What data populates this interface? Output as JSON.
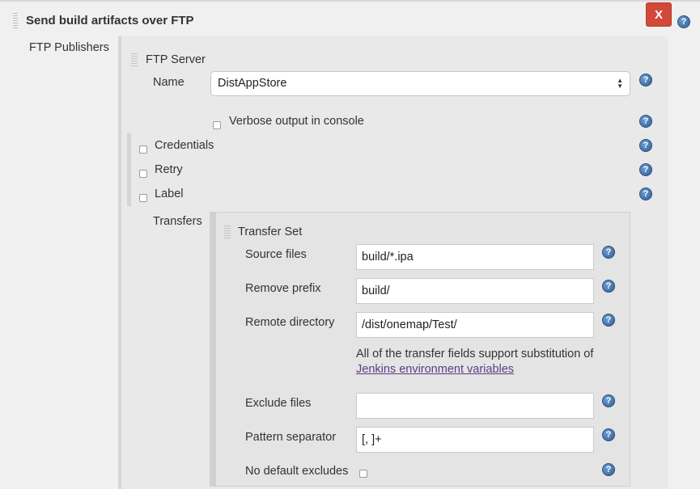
{
  "section": {
    "title": "Send build artifacts over FTP",
    "delete_label": "X"
  },
  "ftp_publishers_label": "FTP Publishers",
  "ftp_server": {
    "heading": "FTP Server",
    "name_label": "Name",
    "name_value": "DistAppStore",
    "verbose_label": "Verbose output in console",
    "verbose_checked": false
  },
  "options": {
    "credentials": "Credentials",
    "retry": "Retry",
    "label": "Label"
  },
  "transfers": {
    "label": "Transfers",
    "set_heading": "Transfer Set",
    "source_files_label": "Source files",
    "source_files_value": "build/*.ipa",
    "remove_prefix_label": "Remove prefix",
    "remove_prefix_value": "build/",
    "remote_directory_label": "Remote directory",
    "remote_directory_value": "/dist/onemap/Test/",
    "note_text": "All of the transfer fields support substitution of",
    "note_link": "Jenkins environment variables",
    "exclude_files_label": "Exclude files",
    "exclude_files_value": "",
    "pattern_separator_label": "Pattern separator",
    "pattern_separator_value": "[, ]+",
    "no_default_excludes_label": "No default excludes"
  },
  "help_glyph": "?",
  "colors": {
    "delete_button": "#d24939",
    "help_icon": "#2f5e98",
    "link": "#5a3d86"
  }
}
